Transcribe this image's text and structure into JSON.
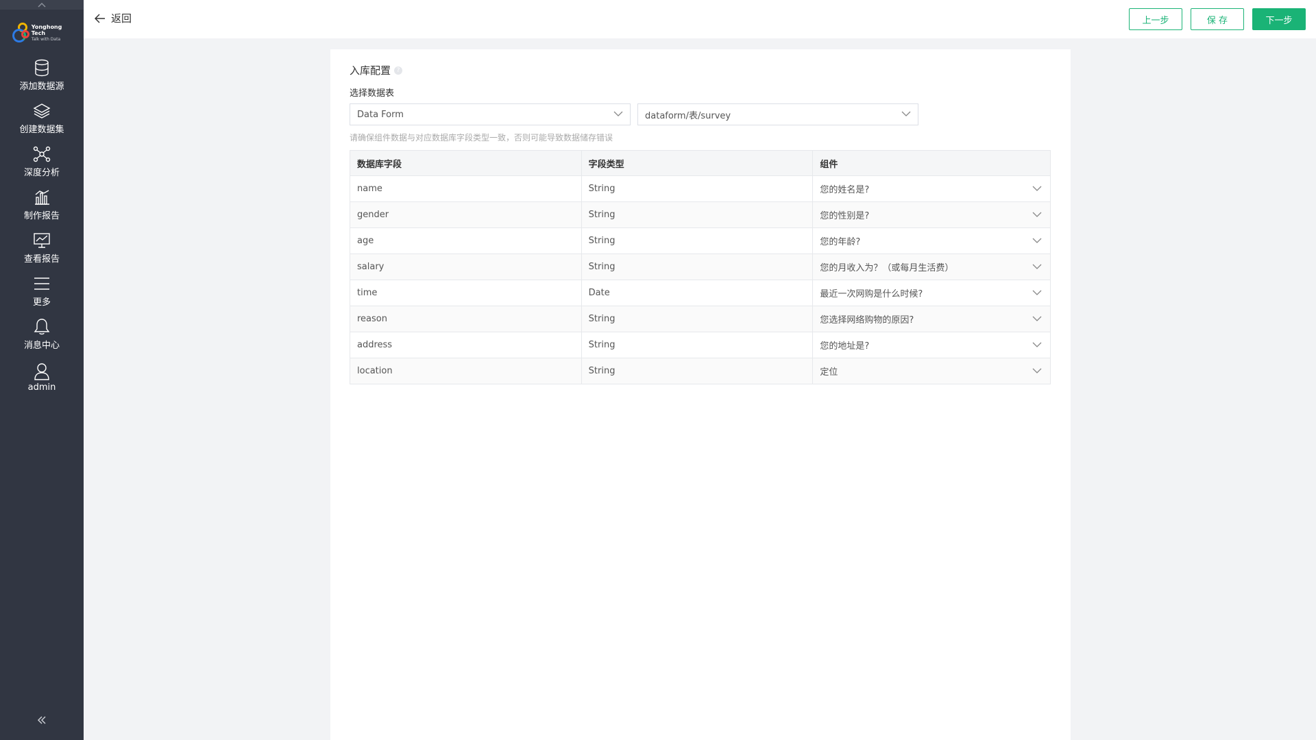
{
  "sidebar": {
    "logo": {
      "name": "Yonghong Tech",
      "tagline": "Talk with Data"
    },
    "items": [
      {
        "label": "添加数据源",
        "icon": "database-icon"
      },
      {
        "label": "创建数据集",
        "icon": "layers-icon"
      },
      {
        "label": "深度分析",
        "icon": "network-icon"
      },
      {
        "label": "制作报告",
        "icon": "bar-chart-icon"
      },
      {
        "label": "查看报告",
        "icon": "monitor-chart-icon"
      },
      {
        "label": "更多",
        "icon": "menu-icon"
      },
      {
        "label": "消息中心",
        "icon": "bell-icon"
      },
      {
        "label": "admin",
        "icon": "user-icon"
      }
    ],
    "collapse_icon": "double-chevron-left-icon"
  },
  "topbar": {
    "back_label": "返回",
    "prev_label": "上一步",
    "save_label": "保 存",
    "next_label": "下一步"
  },
  "form": {
    "section_title": "入库配置",
    "select_label": "选择数据表",
    "source_select": "Data Form",
    "table_select": "dataform/表/survey",
    "hint": "请确保组件数据与对应数据库字段类型一致，否则可能导致数据储存错误"
  },
  "table": {
    "headers": [
      "数据库字段",
      "字段类型",
      "组件"
    ],
    "rows": [
      {
        "field": "name",
        "type": "String",
        "component": "您的姓名是?"
      },
      {
        "field": "gender",
        "type": "String",
        "component": "您的性别是?"
      },
      {
        "field": "age",
        "type": "String",
        "component": "您的年龄?"
      },
      {
        "field": "salary",
        "type": "String",
        "component": "您的月收入为？（或每月生活费）"
      },
      {
        "field": "time",
        "type": "Date",
        "component": "最近一次网购是什么时候?"
      },
      {
        "field": "reason",
        "type": "String",
        "component": "您选择网络购物的原因?"
      },
      {
        "field": "address",
        "type": "String",
        "component": "您的地址是?"
      },
      {
        "field": "location",
        "type": "String",
        "component": "定位"
      }
    ]
  },
  "colors": {
    "accent": "#1ab376",
    "sidebar_bg": "#313642"
  }
}
